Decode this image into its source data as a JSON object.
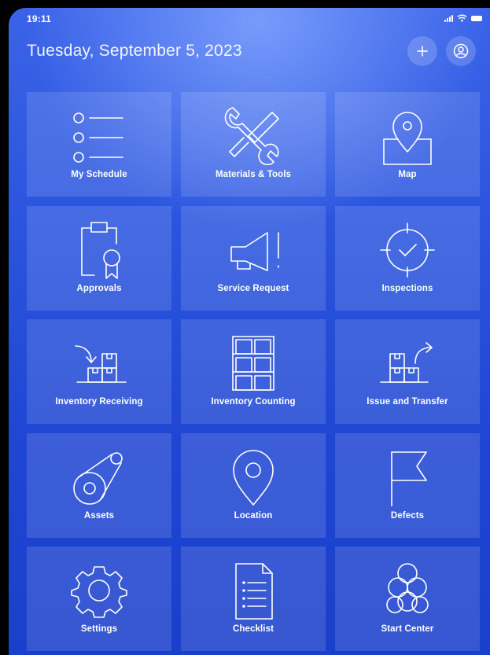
{
  "status_bar": {
    "time": "19:11"
  },
  "header": {
    "date": "Tuesday, September 5, 2023"
  },
  "tiles": [
    {
      "label": "My Schedule",
      "icon": "list-icon"
    },
    {
      "label": "Materials & Tools",
      "icon": "tools-icon"
    },
    {
      "label": "Map",
      "icon": "map-pin-icon"
    },
    {
      "label": "Approvals",
      "icon": "clipboard-ribbon-icon"
    },
    {
      "label": "Service Request",
      "icon": "megaphone-icon"
    },
    {
      "label": "Inspections",
      "icon": "target-check-icon"
    },
    {
      "label": "Inventory Receiving",
      "icon": "receiving-boxes-icon"
    },
    {
      "label": "Inventory Counting",
      "icon": "shelves-boxes-icon"
    },
    {
      "label": "Issue and Transfer",
      "icon": "transfer-boxes-icon"
    },
    {
      "label": "Assets",
      "icon": "asset-tag-icon"
    },
    {
      "label": "Location",
      "icon": "location-pin-icon"
    },
    {
      "label": "Defects",
      "icon": "flag-icon"
    },
    {
      "label": "Settings",
      "icon": "gear-icon"
    },
    {
      "label": "Checklist",
      "icon": "checklist-icon"
    },
    {
      "label": "Start Center",
      "icon": "circles-cluster-icon"
    }
  ],
  "colors": {
    "background_top": "#6f93ff",
    "background_bottom": "#1a3fcb",
    "tile": "rgba(255,255,255,0.13)",
    "text": "#ffffff"
  }
}
